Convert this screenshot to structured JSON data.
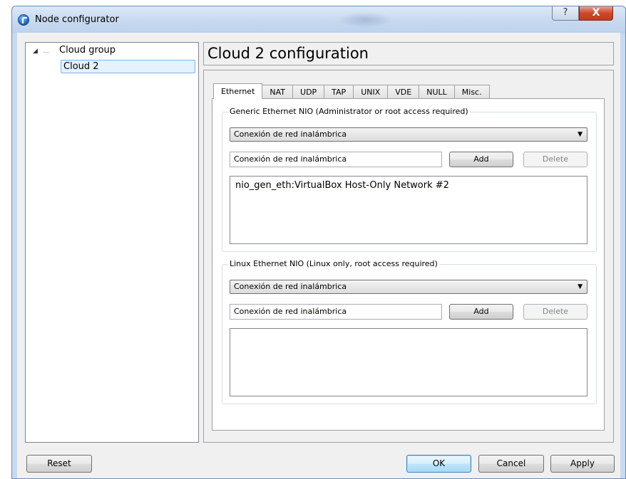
{
  "window": {
    "title": "Node configurator",
    "help_label": "?",
    "close_label": "X"
  },
  "tree": {
    "parent_label": "Cloud group",
    "child_label": "Cloud 2"
  },
  "config": {
    "header": "Cloud 2 configuration",
    "tabs": [
      "Ethernet",
      "NAT",
      "UDP",
      "TAP",
      "UNIX",
      "VDE",
      "NULL",
      "Misc."
    ],
    "active_tab": "Ethernet",
    "generic": {
      "title": "Generic Ethernet NIO (Administrator or root access required)",
      "combo_value": "Conexión de red inalámbrica",
      "input_value": "Conexión de red inalámbrica",
      "add_label": "Add",
      "delete_label": "Delete",
      "list_items": [
        "nio_gen_eth:VirtualBox Host-Only Network #2"
      ]
    },
    "linux": {
      "title": "Linux Ethernet NIO (Linux only, root access required)",
      "combo_value": "Conexión de red inalámbrica",
      "input_value": "Conexión de red inalámbrica",
      "add_label": "Add",
      "delete_label": "Delete",
      "list_items": []
    }
  },
  "buttons": {
    "reset": "Reset",
    "ok": "OK",
    "cancel": "Cancel",
    "apply": "Apply"
  },
  "icons": {
    "app": "app-icon",
    "tree_expand": "expand-arrow-icon",
    "combo_arrow": "dropdown-arrow-icon"
  }
}
